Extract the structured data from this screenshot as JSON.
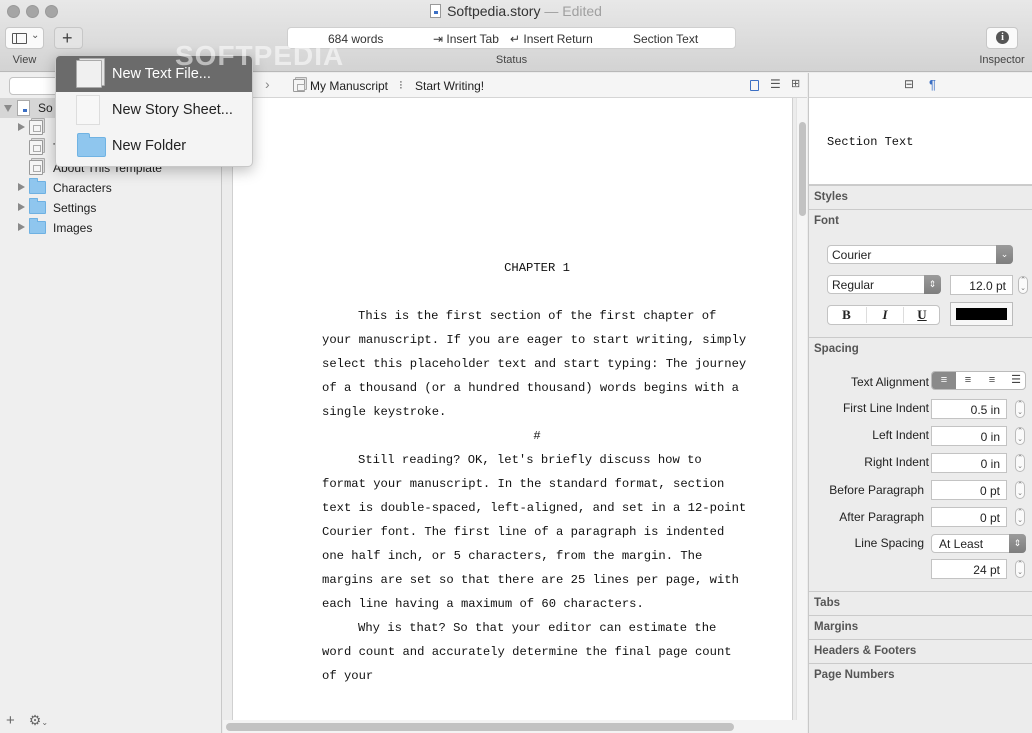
{
  "window": {
    "title": "Softpedia.story",
    "edited_suffix": "— Edited"
  },
  "toolbar": {
    "view_label": "View",
    "status_label": "Status",
    "inspector_label": "Inspector",
    "status": {
      "word_count": "684 words",
      "insert_tab": "⇥ Insert Tab",
      "insert_return": "↵ Insert Return",
      "style": "Section Text"
    }
  },
  "watermark": "SOFTPEDIA",
  "new_menu": {
    "items": [
      {
        "label": "New Text File...",
        "icon": "text-file-icon",
        "selected": true
      },
      {
        "label": "New Story Sheet...",
        "icon": "story-sheet-icon",
        "selected": false
      },
      {
        "label": "New Folder",
        "icon": "folder-icon",
        "selected": false
      }
    ]
  },
  "sidebar": {
    "root": {
      "label": "Softpedia.story",
      "visible_label": "So"
    },
    "items": [
      {
        "label": "",
        "type": "text-stack",
        "expandable": true
      },
      {
        "label": "T",
        "type": "text",
        "expandable": false
      },
      {
        "label": "About This Template",
        "type": "text",
        "expandable": false
      },
      {
        "label": "Characters",
        "type": "folder",
        "expandable": true
      },
      {
        "label": "Settings",
        "type": "folder",
        "expandable": true
      },
      {
        "label": "Images",
        "type": "folder",
        "expandable": true
      }
    ]
  },
  "editor": {
    "breadcrumb": {
      "parent": "My Manuscript",
      "separator": "⁝",
      "current": "Start Writing!"
    },
    "chapter": "CHAPTER 1",
    "paragraphs_before_break": [
      "This is the first section of the first chapter of your manuscript. If you are eager to start writing, simply select this placeholder text and start typing: The journey of a thousand (or a hundred thousand) words begins with a single keystroke."
    ],
    "section_break": "#",
    "paragraphs_after_break": [
      "Still reading? OK, let's briefly discuss how to format your manuscript. In the standard format, section text is double-spaced, left-aligned, and set in a 12-point Courier font. The first line of a paragraph is indented one half inch, or 5 characters, from the margin. The margins are set so that there are 25 lines per page, with each line having a maximum of 60 characters.",
      "Why is that? So that your editor can estimate the word count and accurately determine the final page count of your"
    ]
  },
  "inspector": {
    "style_preview": "Section Text",
    "sections": {
      "styles": "Styles",
      "font": "Font",
      "spacing": "Spacing",
      "tabs": "Tabs",
      "margins": "Margins",
      "headers_footers": "Headers & Footers",
      "page_numbers": "Page Numbers"
    },
    "font": {
      "family": "Courier",
      "typeface": "Regular",
      "size": "12.0 pt",
      "bold": "B",
      "italic": "I",
      "underline": "U",
      "color": "#000000"
    },
    "spacing": {
      "text_alignment_label": "Text Alignment",
      "alignment_selected": "left",
      "first_line_indent_label": "First Line Indent",
      "first_line_indent": "0.5 in",
      "left_indent_label": "Left Indent",
      "left_indent": "0 in",
      "right_indent_label": "Right Indent",
      "right_indent": "0 in",
      "before_paragraph_label": "Before Paragraph",
      "before_paragraph": "0 pt",
      "after_paragraph_label": "After Paragraph",
      "after_paragraph": "0 pt",
      "line_spacing_label": "Line Spacing",
      "line_spacing": "At Least",
      "line_spacing_value": "24 pt"
    }
  }
}
